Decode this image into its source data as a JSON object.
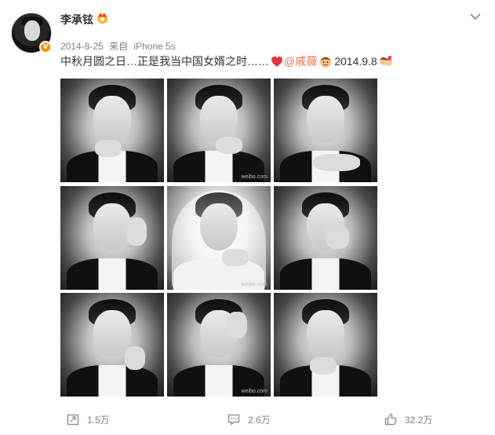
{
  "post": {
    "username": "李承铉",
    "date": "2014-8-25",
    "source_prefix": "来自",
    "source_device": "iPhone 5s",
    "text_before_mention": "中秋月圆之日…正是我当中国女婿之时……",
    "mention": "@戚薇",
    "text_after_mention": "2014.9.8",
    "verified_badge": "V",
    "photo_watermark": "weibo.com"
  },
  "photos": [
    {
      "id": "photo-1",
      "type": "groom"
    },
    {
      "id": "photo-2",
      "type": "groom"
    },
    {
      "id": "photo-3",
      "type": "groom"
    },
    {
      "id": "photo-4",
      "type": "groom"
    },
    {
      "id": "photo-5",
      "type": "bride"
    },
    {
      "id": "photo-6",
      "type": "groom"
    },
    {
      "id": "photo-7",
      "type": "groom"
    },
    {
      "id": "photo-8",
      "type": "groom"
    },
    {
      "id": "photo-9",
      "type": "groom"
    }
  ],
  "actions": {
    "repost_count": "1.5万",
    "comment_count": "2.6万",
    "like_count": "32.2万"
  },
  "colors": {
    "mention": "#eb7350",
    "meta_text": "#808080",
    "verified": "#f29100",
    "heart": "#e8323c"
  },
  "icons": [
    "crown-icon",
    "chevron-down-icon",
    "heart-icon",
    "emoji-icon",
    "repost-icon",
    "comment-icon",
    "like-icon"
  ]
}
